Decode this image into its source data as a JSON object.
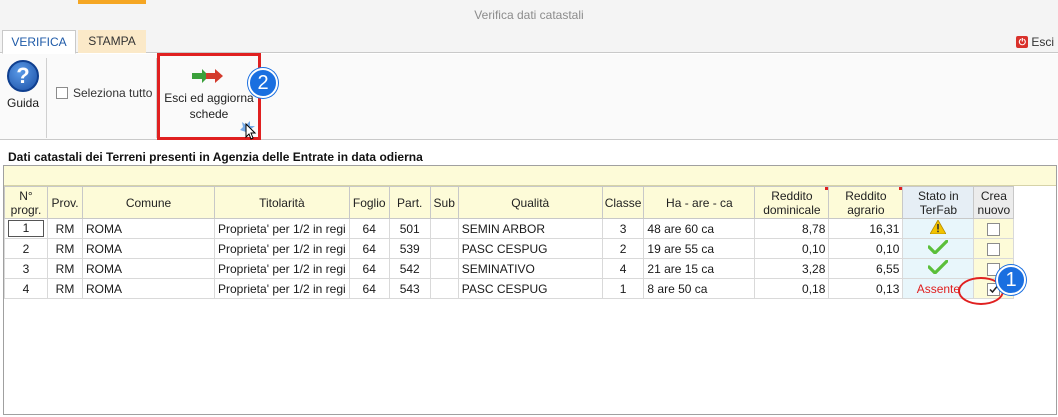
{
  "window": {
    "title": "Verifica dati catastali"
  },
  "tabs": [
    {
      "label": "VERIFICA",
      "active": true
    },
    {
      "label": "STAMPA",
      "active": false
    }
  ],
  "exit": {
    "label": "Esci"
  },
  "toolbar": {
    "help_label": "Guida",
    "select_all_label": "Seleziona tutto",
    "update_label": "Esci ed aggiorna schede"
  },
  "callouts": {
    "one": "1",
    "two": "2"
  },
  "section_title": "Dati catastali dei Terreni presenti in Agenzia delle Entrate in data odierna",
  "table": {
    "headers": {
      "n": "N° progr.",
      "prov": "Prov.",
      "comune": "Comune",
      "titolarita": "Titolarità",
      "foglio": "Foglio",
      "part": "Part.",
      "sub": "Sub",
      "qualita": "Qualità",
      "classe": "Classe",
      "ha": "Ha - are - ca",
      "dominicale": "Reddito dominicale",
      "agrario": "Reddito agrario",
      "stato": "Stato in TerFab",
      "crea": "Crea nuovo"
    },
    "rows": [
      {
        "n": "1",
        "prov": "RM",
        "comune": "ROMA",
        "titolarita": "Proprieta' per 1/2 in regi",
        "foglio": "64",
        "part": "501",
        "sub": "",
        "qualita": "SEMIN ARBOR",
        "classe": "3",
        "ha": "48 are 60 ca",
        "dominicale": "8,78",
        "agrario": "16,31",
        "stato": "warning",
        "crea": false
      },
      {
        "n": "2",
        "prov": "RM",
        "comune": "ROMA",
        "titolarita": "Proprieta' per 1/2 in regi",
        "foglio": "64",
        "part": "539",
        "sub": "",
        "qualita": "PASC CESPUG",
        "classe": "2",
        "ha": "19 are 55 ca",
        "dominicale": "0,10",
        "agrario": "0,10",
        "stato": "ok",
        "crea": false
      },
      {
        "n": "3",
        "prov": "RM",
        "comune": "ROMA",
        "titolarita": "Proprieta' per 1/2 in regi",
        "foglio": "64",
        "part": "542",
        "sub": "",
        "qualita": "SEMINATIVO",
        "classe": "4",
        "ha": "21 are 15 ca",
        "dominicale": "3,28",
        "agrario": "6,55",
        "stato": "ok",
        "crea": false
      },
      {
        "n": "4",
        "prov": "RM",
        "comune": "ROMA",
        "titolarita": "Proprieta' per 1/2 in regi",
        "foglio": "64",
        "part": "543",
        "sub": "",
        "qualita": "PASC CESPUG",
        "classe": "1",
        "ha": "8 are 50 ca",
        "dominicale": "0,18",
        "agrario": "0,13",
        "stato": "Assente",
        "crea": true
      }
    ]
  },
  "colors": {
    "accent": "#1a6fe0",
    "highlight": "#e02020",
    "tab_stampa": "#fbe9c8",
    "filter_row": "#fdfbd8"
  }
}
